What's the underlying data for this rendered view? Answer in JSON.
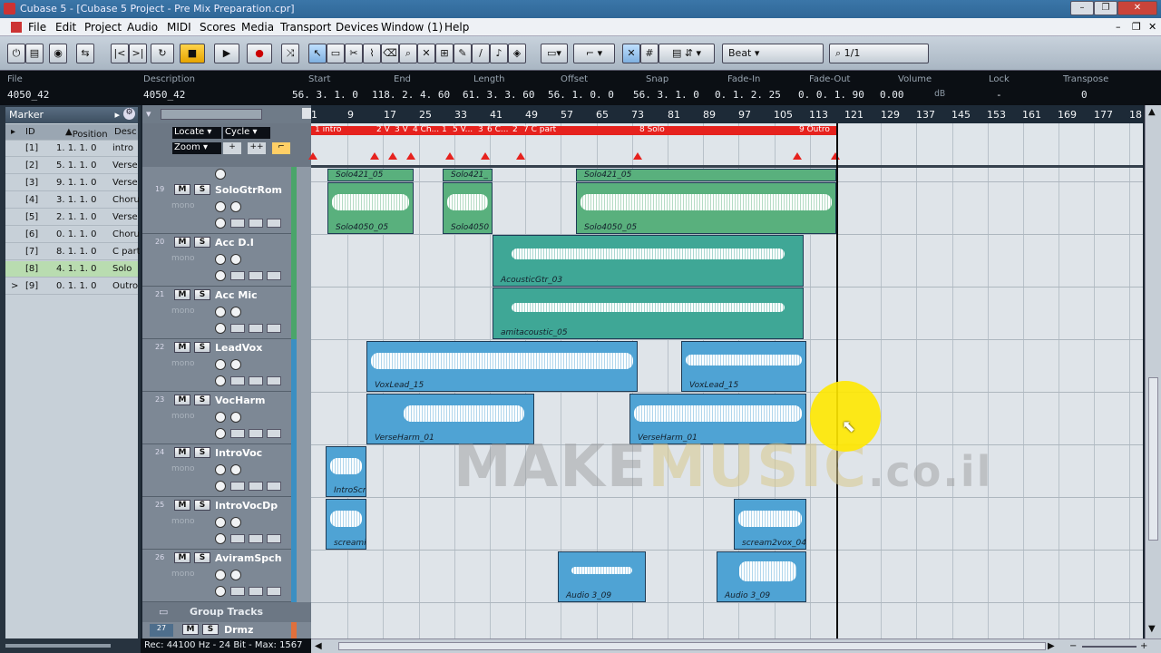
{
  "window": {
    "title": "Cubase 5 - [Cubase 5 Project - Pre Mix Preparation.cpr]"
  },
  "menu": [
    "File",
    "Edit",
    "Project",
    "Audio",
    "MIDI",
    "Scores",
    "Media",
    "Transport",
    "Devices",
    "Window (1)",
    "Help"
  ],
  "toolbar": {
    "snap_type": "Beat",
    "quantize": "1/1"
  },
  "infoline": {
    "fields": [
      {
        "label": "File",
        "value": "4050_42"
      },
      {
        "label": "Description",
        "value": "4050_42"
      },
      {
        "label": "Start",
        "value": "56. 3. 1.  0"
      },
      {
        "label": "End",
        "value": "118. 2. 4. 60"
      },
      {
        "label": "Length",
        "value": "61. 3. 3. 60"
      },
      {
        "label": "Offset",
        "value": "56. 1. 0.  0"
      },
      {
        "label": "Snap",
        "value": "56. 3. 1.  0"
      },
      {
        "label": "Fade-In",
        "value": "0. 1. 2. 25"
      },
      {
        "label": "Fade-Out",
        "value": "0. 0. 1. 90"
      },
      {
        "label": "Volume",
        "value": "0.00"
      },
      {
        "label": "Lock",
        "value": "-"
      },
      {
        "label": "Transpose",
        "value": "0"
      }
    ],
    "volume_unit": "dB"
  },
  "marker_panel": {
    "title": "Marker",
    "columns": [
      "ID",
      "Position",
      "Desc"
    ],
    "rows": [
      {
        "id": "[1]",
        "pos": "1. 1. 1.   0",
        "desc": "intro"
      },
      {
        "id": "[2]",
        "pos": "5. 1. 1.   0",
        "desc": "Verse"
      },
      {
        "id": "[3]",
        "pos": "9. 1. 1.   0",
        "desc": "Verse"
      },
      {
        "id": "[4]",
        "pos": "3. 1. 1.   0",
        "desc": "Chorus"
      },
      {
        "id": "[5]",
        "pos": "2. 1. 1.   0",
        "desc": "Verse"
      },
      {
        "id": "[6]",
        "pos": "0. 1. 1.   0",
        "desc": "Chorus"
      },
      {
        "id": "[7]",
        "pos": "8. 1. 1.   0",
        "desc": "C part"
      },
      {
        "id": "[8]",
        "pos": "4. 1. 1.   0",
        "desc": "Solo"
      },
      {
        "id": "[9]",
        "pos": "0. 1. 1.   0",
        "desc": "Outro"
      }
    ]
  },
  "marker_track": {
    "locate": "Locate",
    "cycle": "Cycle",
    "zoom": "Zoom"
  },
  "tracks": [
    {
      "num": "19",
      "name": "SoloGtrRom",
      "color": "#4aa56a"
    },
    {
      "num": "20",
      "name": "Acc D.I",
      "color": "#4aa56a"
    },
    {
      "num": "21",
      "name": "Acc Mic",
      "color": "#4aa56a"
    },
    {
      "num": "22",
      "name": "LeadVox",
      "color": "#3b8fc2"
    },
    {
      "num": "23",
      "name": "VocHarm",
      "color": "#3b8fc2"
    },
    {
      "num": "24",
      "name": "IntroVoc",
      "color": "#3b8fc2"
    },
    {
      "num": "25",
      "name": "IntroVocDp",
      "color": "#3b8fc2"
    },
    {
      "num": "26",
      "name": "AviramSpch",
      "color": "#3b8fc2"
    }
  ],
  "track_mode": "mono",
  "group_tracks": {
    "label": "Group Tracks",
    "drmz_num": "27",
    "drmz_name": "Drmz"
  },
  "ruler": [
    "1",
    "9",
    "17",
    "25",
    "33",
    "41",
    "49",
    "57",
    "65",
    "73",
    "81",
    "89",
    "97",
    "105",
    "113",
    "121",
    "129",
    "137",
    "145",
    "153",
    "161",
    "169",
    "177",
    "18"
  ],
  "markers_bar": [
    "1 intro",
    "2 V",
    "3 V",
    "4 Ch...",
    "1",
    "5 V...",
    "3",
    "6 C...",
    "2",
    "7 C part",
    "8 Solo",
    "9 Outro"
  ],
  "events": [
    {
      "label": "Solo421_05"
    },
    {
      "label": "Solo421_"
    },
    {
      "label": "Solo421_05"
    },
    {
      "label": "Solo4050_05"
    },
    {
      "label": "Solo4050"
    },
    {
      "label": "Solo4050_05"
    },
    {
      "label": "AcousticGtr_03"
    },
    {
      "label": "amitacoustic_05"
    },
    {
      "label": "VoxLead_15"
    },
    {
      "label": "VoxLead_15"
    },
    {
      "label": "VerseHarm_01"
    },
    {
      "label": "VerseHarm_01"
    },
    {
      "label": "IntroScr"
    },
    {
      "label": "screami"
    },
    {
      "label": "scream2vox_04"
    },
    {
      "label": "Audio 3_09"
    },
    {
      "label": "Audio 3_09"
    }
  ],
  "status": "Rec: 44100 Hz - 24 Bit - Max: 1567",
  "watermark": {
    "part1": "MAKE",
    "part2": "MUSIC",
    "part3": ".co.il"
  }
}
